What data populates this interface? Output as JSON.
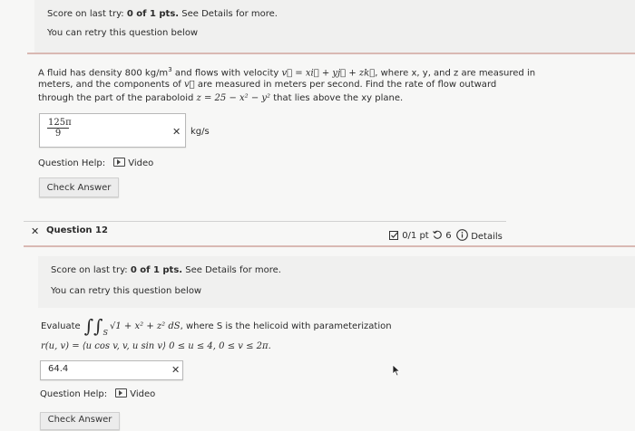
{
  "top_feedback": {
    "score_prefix": "Score on last try: ",
    "score_value": "0 of 1 pts.",
    "score_suffix": " See Details for more.",
    "retry": "You can retry this question below"
  },
  "q11": {
    "problem_line1_a": "A fluid has density 800 kg/m",
    "problem_line1_sup": "3",
    "problem_line1_b": " and flows with velocity ",
    "velocity_expr": "v⃗ = xi⃗ + yj⃗ + zk⃗",
    "problem_line1_c": ", where x, y, and z are measured in",
    "problem_line2_a": "meters, and the components of ",
    "problem_line2_v": "v⃗",
    "problem_line2_b": " are measured in meters per second. Find the rate of flow outward",
    "problem_line3_a": "through the part of the paraboloid ",
    "paraboloid_expr": "z = 25 − x² − y²",
    "problem_line3_b": " that lies above the xy plane.",
    "answer_numerator": "125π",
    "answer_denominator": "9",
    "answer_status": "✕",
    "unit": "kg/s",
    "help_label": "Question Help:",
    "video_label": "Video",
    "check_button": "Check Answer"
  },
  "q12_header": {
    "status_mark": "✕",
    "title": "Question 12",
    "score": "0/1 pt",
    "retries": "6",
    "details": "Details"
  },
  "q12": {
    "score_prefix": "Score on last try: ",
    "score_value": "0 of 1 pts.",
    "score_suffix": " See Details for more.",
    "retry": "You can retry this question below",
    "evaluate_label": "Evaluate",
    "integral_expr": "∫∫",
    "integral_sub": "S",
    "integrand": "√1 + x² + z² dS",
    "evaluate_suffix": ", where S is the helicoid with parameterization",
    "param_line": "r(u, v) = ⟨u cos v, v, u sin v⟩  0 ≤ u ≤ 4,  0 ≤ v ≤ 2π.",
    "answer_value": "64.4",
    "answer_status": "✕",
    "help_label": "Question Help:",
    "video_label": "Video",
    "check_button": "Check Answer"
  }
}
